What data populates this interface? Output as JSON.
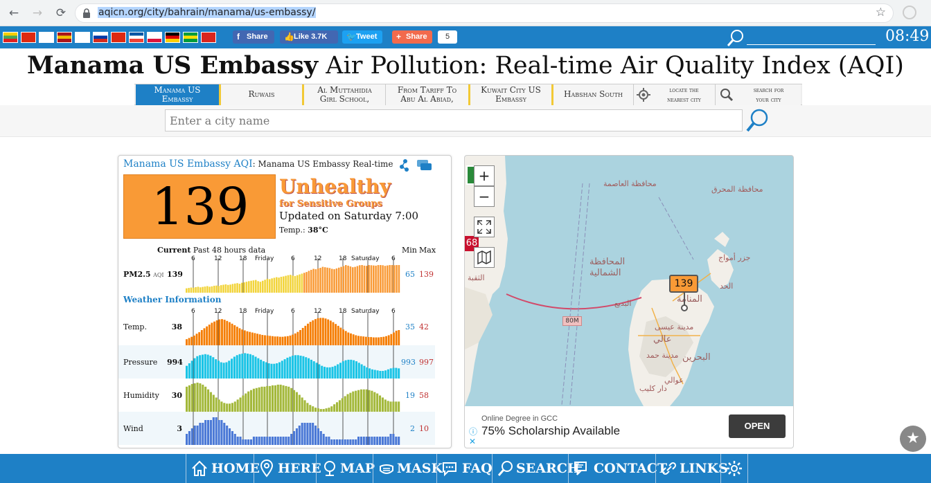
{
  "browser": {
    "url": "aqicn.org/city/bahrain/manama/us-embassy/"
  },
  "topbar": {
    "flags": [
      {
        "name": "myanmar",
        "colors": [
          "#f7ce00",
          "#4aa657",
          "#e02020"
        ]
      },
      {
        "name": "china",
        "colors": [
          "#de2910",
          "#de2910",
          "#de2910"
        ]
      },
      {
        "name": "japan",
        "colors": [
          "#ffffff",
          "#ffffff",
          "#ffffff"
        ]
      },
      {
        "name": "spain",
        "colors": [
          "#aa151b",
          "#f1bf00",
          "#aa151b"
        ]
      },
      {
        "name": "korea",
        "colors": [
          "#ffffff",
          "#ffffff",
          "#ffffff"
        ]
      },
      {
        "name": "russia",
        "colors": [
          "#ffffff",
          "#0039a6",
          "#d52b1e"
        ]
      },
      {
        "name": "hongkong",
        "colors": [
          "#de2910",
          "#de2910",
          "#de2910"
        ]
      },
      {
        "name": "france",
        "colors": [
          "#0055a4",
          "#ffffff",
          "#ef4135"
        ]
      },
      {
        "name": "poland",
        "colors": [
          "#ffffff",
          "#ffffff",
          "#dc143c"
        ]
      },
      {
        "name": "germany",
        "colors": [
          "#000000",
          "#dd0000",
          "#ffce00"
        ]
      },
      {
        "name": "brazil",
        "colors": [
          "#009c3b",
          "#ffdf00",
          "#009c3b"
        ]
      },
      {
        "name": "vietnam",
        "colors": [
          "#da251d",
          "#da251d",
          "#da251d"
        ]
      }
    ],
    "facebook_share": "Share",
    "facebook_like": "Like 3.7K",
    "tweet": "Tweet",
    "share": "Share",
    "share_count": "5",
    "clock": "08:49"
  },
  "title": {
    "bold": "Manama US Embassy",
    "rest": " Air Pollution: Real-time Air Quality Index (AQI)"
  },
  "tabs": [
    {
      "line1": "Manama US",
      "line2": "Embassy"
    },
    {
      "line1": "Ruwais",
      "line2": ""
    },
    {
      "line1": "Al Muttahidia",
      "line2": "Girl School,"
    },
    {
      "line1": "From Tariff To",
      "line2": "Abu Al Abiad,"
    },
    {
      "line1": "Kuwait City US",
      "line2": "Embassy"
    },
    {
      "line1": "Habshan South",
      "line2": ""
    },
    {
      "line1": "locate the",
      "line2": "nearest city"
    },
    {
      "line1": "search for",
      "line2": "your city"
    }
  ],
  "search": {
    "placeholder": "Enter a city name"
  },
  "panel": {
    "city": "Manama US Embassy",
    "aqi_label": "AQI",
    "subtitle": ": Manama US Embassy Real-time",
    "aqi": "139",
    "status_line1": "Unhealthy",
    "status_line2": "for Sensitive Groups",
    "updated": "Updated on Saturday 7:00",
    "temp_label": "Temp.: ",
    "temp_value": "38°C",
    "col_current": "Current",
    "col_past": "Past 48 hours data",
    "col_min": "Min",
    "col_max": "Max",
    "ticks": [
      "6",
      "12",
      "18",
      "Friday",
      "6",
      "12",
      "18",
      "Saturday",
      "6"
    ],
    "weather_heading": "Weather Information",
    "rows": [
      {
        "label": "PM2.5",
        "sub": "AQI",
        "current": "139",
        "min": "65",
        "max": "139"
      },
      {
        "label": "Temp.",
        "sub": "",
        "current": "38",
        "min": "35",
        "max": "42"
      },
      {
        "label": "Pressure",
        "sub": "",
        "current": "994",
        "min": "993",
        "max": "997"
      },
      {
        "label": "Humidity",
        "sub": "",
        "current": "30",
        "min": "19",
        "max": "58"
      },
      {
        "label": "Wind",
        "sub": "",
        "current": "3",
        "min": "2",
        "max": "10"
      }
    ]
  },
  "map": {
    "zoom_in": "+",
    "zoom_out": "−",
    "marker": "139",
    "edge_marker": "68",
    "road_label": "80M",
    "places": [
      {
        "name": "محافظة العاصمة"
      },
      {
        "name": "محافظة المحرق"
      },
      {
        "name": "جزر أمواج"
      },
      {
        "name": "المحافظة"
      },
      {
        "name": "الشمالية"
      },
      {
        "name": "الحد"
      },
      {
        "name": "البديع"
      },
      {
        "name": "المنامة"
      },
      {
        "name": "مدينة عيسى"
      },
      {
        "name": "عالي"
      },
      {
        "name": "مدينة حمد"
      },
      {
        "name": "البحرين"
      },
      {
        "name": "عوالي"
      },
      {
        "name": "دار كليب"
      },
      {
        "name": "الثقبة"
      }
    ]
  },
  "ad": {
    "small": "Online Degree in GCC",
    "big": "75% Scholarship Available",
    "button": "OPEN"
  },
  "bottom_nav": [
    {
      "label": "HOME",
      "icon": "home-icon"
    },
    {
      "label": "HERE",
      "icon": "location-pin-icon"
    },
    {
      "label": "MAP",
      "icon": "map-icon"
    },
    {
      "label": "MASK",
      "icon": "mask-icon"
    },
    {
      "label": "FAQ",
      "icon": "faq-icon"
    },
    {
      "label": "SEARCH",
      "icon": "search-icon"
    },
    {
      "label": "CONTACT",
      "icon": "contact-icon"
    },
    {
      "label": "LINKS",
      "icon": "link-icon"
    },
    {
      "label": "",
      "icon": "gear-icon"
    }
  ],
  "chart_data": [
    {
      "type": "bar",
      "name": "PM2.5 AQI past 48 hours",
      "color": "#f2d43a",
      "ylim": [
        0,
        160
      ],
      "values": [
        22,
        24,
        26,
        25,
        28,
        30,
        27,
        29,
        31,
        33,
        30,
        32,
        35,
        36,
        34,
        38,
        40,
        42,
        39,
        41,
        44,
        46,
        48,
        45,
        50,
        52,
        55,
        58,
        60,
        62,
        64,
        58,
        55,
        60,
        65,
        70,
        68,
        72,
        75,
        78,
        76,
        80,
        82,
        85,
        88,
        90,
        86,
        84,
        88,
        92,
        96,
        100,
        104,
        110,
        115,
        120,
        118,
        122,
        125,
        130,
        128,
        126,
        124,
        120,
        118,
        122,
        126,
        130,
        134,
        139,
        136,
        132,
        128,
        130,
        134,
        138,
        139,
        136,
        135,
        139,
        138,
        137,
        136,
        139,
        139,
        138,
        135,
        137,
        139,
        139,
        138,
        139,
        139
      ]
    },
    {
      "type": "bar",
      "name": "Temp. past 48 hours",
      "color": "#f57c00",
      "ylim": [
        33,
        43
      ],
      "values": [
        35,
        35.4,
        35.8,
        36.2,
        36.8,
        37.3,
        38,
        38.6,
        39.2,
        39.8,
        40.4,
        40.8,
        41.2,
        41.5,
        41.6,
        41.4,
        41,
        40.6,
        40.1,
        39.6,
        39.1,
        38.6,
        38.2,
        37.9,
        37.6,
        37.4,
        37.2,
        37,
        36.8,
        36.6,
        36.4,
        36.3,
        36.2,
        36.1,
        36,
        35.9,
        35.9,
        35.8,
        35.8,
        35.9,
        36,
        36.2,
        36.5,
        36.9,
        37.4,
        38,
        38.7,
        39.4,
        40.1,
        40.7,
        41.2,
        41.6,
        41.9,
        42,
        42,
        41.8,
        41.5,
        41.1,
        40.6,
        40,
        39.4,
        38.8,
        38.2,
        37.7,
        37.2,
        36.9,
        36.6,
        36.3,
        36.1,
        36,
        35.9,
        35.8,
        35.7,
        35.7,
        35.6,
        35.6,
        35.6,
        35.7,
        35.8,
        36,
        36.3,
        36.7,
        37.2,
        37.8,
        38
      ]
    },
    {
      "type": "bar",
      "name": "Pressure past 48 hours",
      "color": "#19c4e6",
      "ylim": [
        992,
        998
      ],
      "values": [
        994.5,
        995,
        995.5,
        996,
        996.4,
        996.6,
        996.7,
        996.8,
        996.7,
        996.5,
        996.2,
        995.8,
        995.5,
        995.2,
        995.1,
        995.2,
        995.5,
        995.9,
        996.3,
        996.6,
        996.8,
        996.9,
        997,
        996.9,
        996.8,
        996.6,
        996.3,
        996,
        995.7,
        995.4,
        995.2,
        995,
        994.9,
        994.9,
        995,
        995.2,
        995.5,
        995.8,
        996.1,
        996.3,
        996.5,
        996.6,
        996.6,
        996.5,
        996.4,
        996.2,
        996,
        995.7,
        995.4,
        995.1,
        994.8,
        994.5,
        994.3,
        994.2,
        994.2,
        994.3,
        994.5,
        994.8,
        995.1,
        995.4,
        995.6,
        995.7,
        995.7,
        995.6,
        995.4,
        995.1,
        994.8,
        994.5,
        994.2,
        994,
        993.8,
        993.7,
        993.6,
        993.5,
        993.5,
        993.6,
        993.8,
        994,
        994.1,
        994.1,
        994
      ]
    },
    {
      "type": "bar",
      "name": "Humidity past 48 hours",
      "color": "#a3b83a",
      "ylim": [
        15,
        60
      ],
      "values": [
        52,
        54,
        56,
        57,
        58,
        57,
        55,
        52,
        48,
        44,
        40,
        36,
        33,
        30,
        28,
        27,
        27,
        28,
        30,
        33,
        36,
        39,
        42,
        45,
        47,
        49,
        50,
        51,
        52,
        52,
        53,
        53,
        54,
        54,
        55,
        55,
        54,
        53,
        52,
        50,
        47,
        44,
        40,
        36,
        32,
        28,
        25,
        23,
        21,
        20,
        19,
        19,
        20,
        21,
        23,
        26,
        29,
        32,
        35,
        38,
        41,
        43,
        45,
        46,
        47,
        48,
        48,
        48,
        47,
        46,
        44,
        42,
        39,
        36,
        33,
        31,
        30,
        30,
        30,
        30
      ]
    },
    {
      "type": "bar",
      "name": "Wind past 48 hours",
      "color": "#4a78d6",
      "ylim": [
        0,
        11
      ],
      "values": [
        4,
        5,
        6,
        7,
        7,
        8,
        8,
        9,
        9,
        9,
        10,
        10,
        9,
        9,
        8,
        7,
        6,
        5,
        4,
        3,
        3,
        2,
        2,
        2,
        2,
        3,
        3,
        3,
        3,
        3,
        3,
        3,
        3,
        3,
        3,
        3,
        3,
        3,
        3,
        4,
        5,
        6,
        7,
        8,
        8,
        8,
        8,
        8,
        7,
        6,
        5,
        4,
        3,
        3,
        2,
        2,
        2,
        2,
        2,
        2,
        2,
        2,
        2,
        2,
        3,
        3,
        3,
        3,
        3,
        3,
        3,
        3,
        3,
        3,
        3,
        3,
        4,
        4,
        3,
        3
      ]
    }
  ]
}
